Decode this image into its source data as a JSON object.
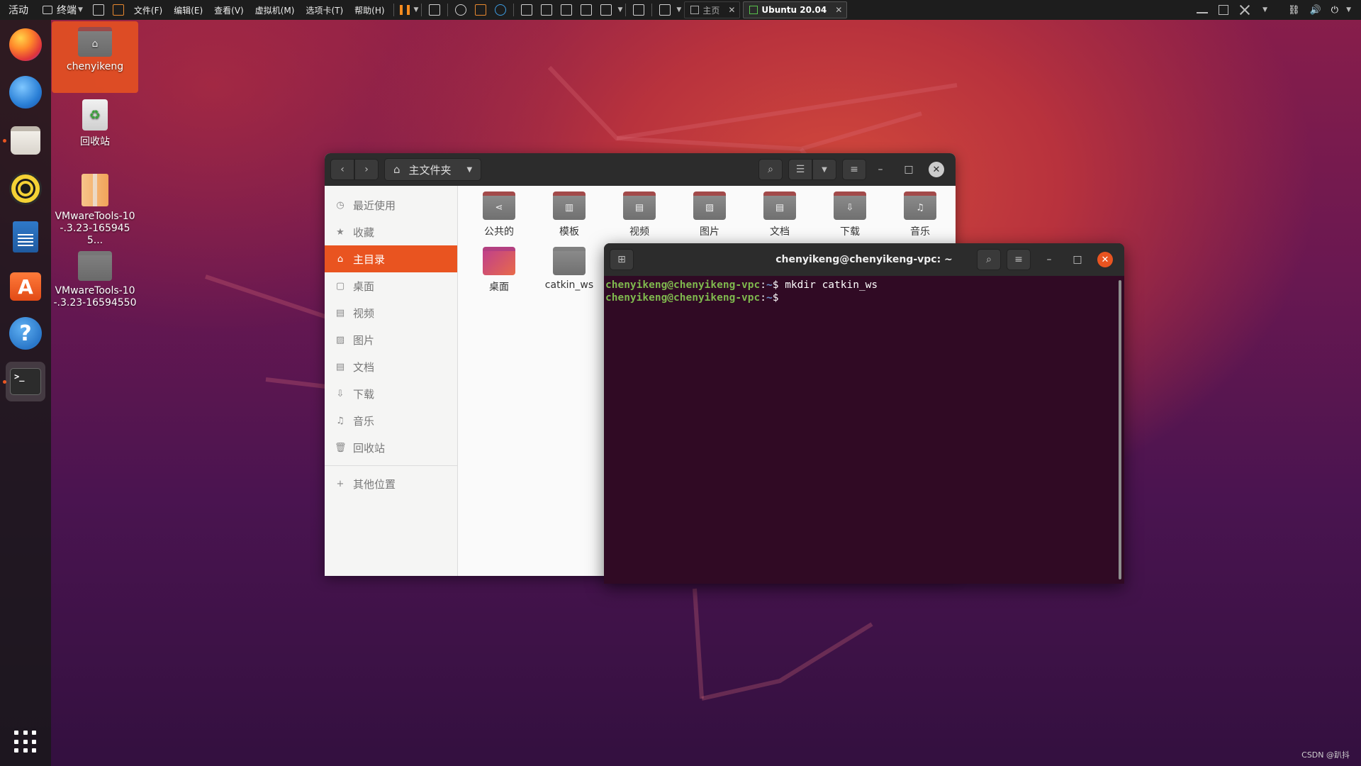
{
  "topbar": {
    "activities": "活动",
    "app_menu": "终端",
    "menus": [
      "文件(F)",
      "编辑(E)",
      "查看(V)",
      "虚拟机(M)",
      "选项卡(T)",
      "帮助(H)"
    ],
    "tabs": [
      {
        "label": "主页",
        "active": false
      },
      {
        "label": "Ubuntu 20.04",
        "active": true
      }
    ]
  },
  "desktop": {
    "icons": [
      {
        "label": "chenyikeng",
        "icon": "home-folder-icon"
      },
      {
        "label": "回收站",
        "icon": "trash-icon"
      },
      {
        "label": "VMwareTools-10-.3.23-1659455...",
        "icon": "archive-icon"
      },
      {
        "label": "VMwareTools-10-.3.23-16594550",
        "icon": "folder-icon"
      }
    ]
  },
  "dock": {
    "apps": [
      "firefox",
      "thunderbird",
      "files",
      "rhythmbox",
      "libreoffice-writer",
      "ubuntu-software",
      "help",
      "terminal"
    ]
  },
  "files": {
    "path_label": "主文件夹",
    "sidebar": [
      {
        "label": "最近使用",
        "icon": "clock-icon"
      },
      {
        "label": "收藏",
        "icon": "star-icon"
      },
      {
        "label": "主目录",
        "icon": "home-icon",
        "active": true
      },
      {
        "label": "桌面",
        "icon": "desktop-icon"
      },
      {
        "label": "视频",
        "icon": "video-icon"
      },
      {
        "label": "图片",
        "icon": "picture-icon"
      },
      {
        "label": "文档",
        "icon": "document-icon"
      },
      {
        "label": "下载",
        "icon": "download-icon"
      },
      {
        "label": "音乐",
        "icon": "music-icon"
      },
      {
        "label": "回收站",
        "icon": "trash-icon"
      },
      {
        "label": "其他位置",
        "icon": "plus-icon"
      }
    ],
    "items": [
      {
        "label": "公共的",
        "icon": "share-icon"
      },
      {
        "label": "模板",
        "icon": "template-icon"
      },
      {
        "label": "视频",
        "icon": "video-icon"
      },
      {
        "label": "图片",
        "icon": "picture-icon"
      },
      {
        "label": "文档",
        "icon": "document-icon"
      },
      {
        "label": "下载",
        "icon": "download-icon"
      },
      {
        "label": "音乐",
        "icon": "music-icon"
      },
      {
        "label": "桌面",
        "icon": "desktop-icon"
      },
      {
        "label": "catkin_ws",
        "icon": "folder-icon"
      }
    ]
  },
  "terminal": {
    "title": "chenyikeng@chenyikeng-vpc: ~",
    "lines": [
      {
        "user": "chenyikeng@chenyikeng-vpc",
        "sep": ":",
        "path": "~",
        "prompt": "$ ",
        "command": "mkdir catkin_ws"
      },
      {
        "user": "chenyikeng@chenyikeng-vpc",
        "sep": ":",
        "path": "~",
        "prompt": "$",
        "command": ""
      }
    ]
  },
  "watermark": "CSDN @趴抖",
  "colors": {
    "accent": "#e95420",
    "terminal_bg": "#300a24",
    "prompt_user": "#7fb84e",
    "prompt_path": "#6a8ec8"
  }
}
